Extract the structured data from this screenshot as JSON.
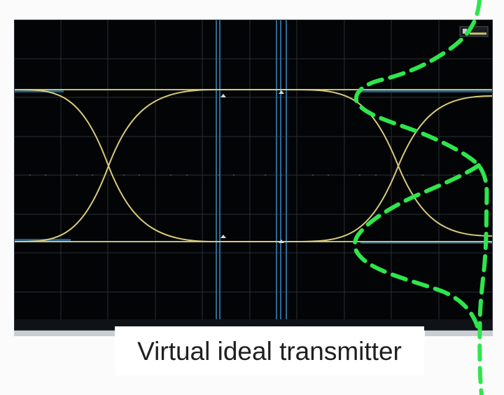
{
  "caption": {
    "text": "Virtual ideal transmitter"
  },
  "colors": {
    "background": "#fbfbfb",
    "scope_bg": "#030405",
    "grid": "#2a3038",
    "blue_marker": "#3b7fb2",
    "eye_trace": "#d6ca79",
    "eye_trace_dim": "#8f8b5b",
    "green_curve": "#2ee64c"
  }
}
